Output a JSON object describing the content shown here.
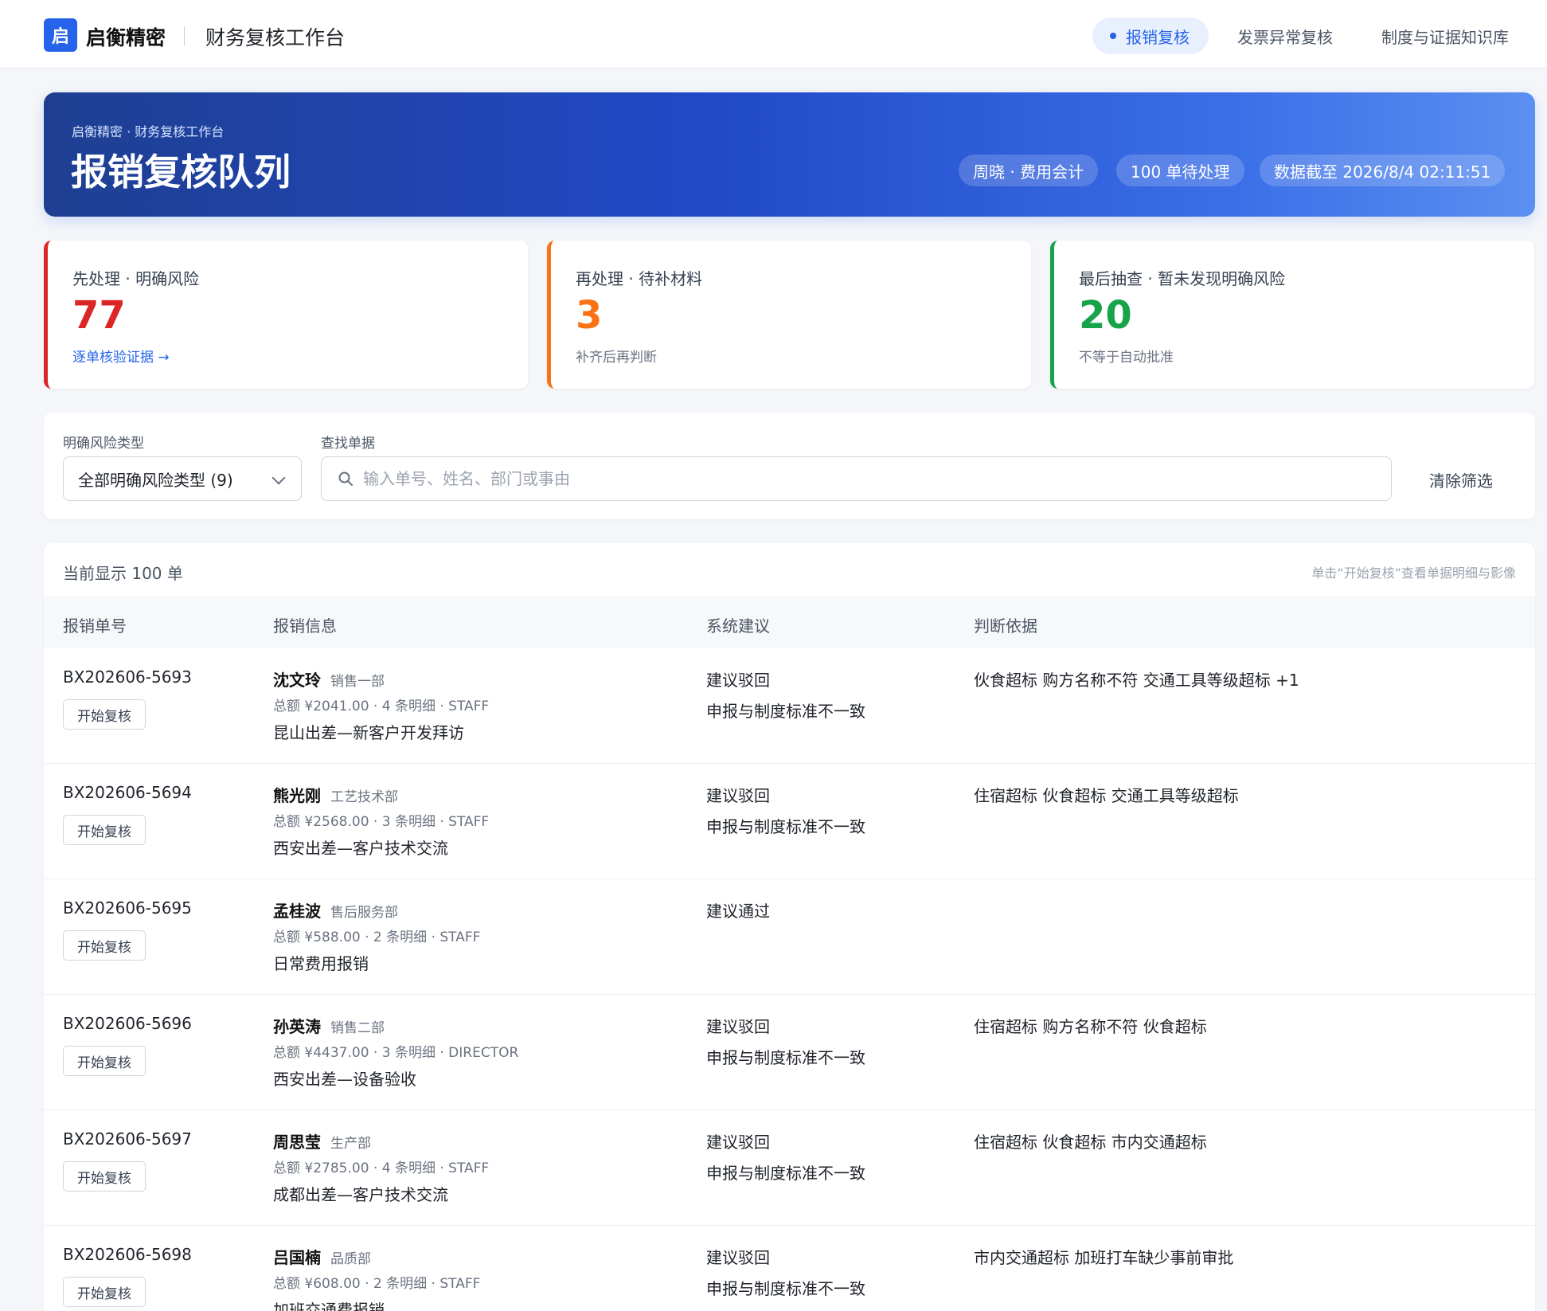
{
  "app": {
    "logo_char": "启",
    "brand": "启衡精密",
    "subtitle": "财务复核工作台"
  },
  "nav": {
    "items": [
      {
        "label": "报销复核",
        "active": true
      },
      {
        "label": "发票异常复核",
        "active": false
      },
      {
        "label": "制度与证据知识库",
        "active": false
      }
    ]
  },
  "banner": {
    "crumb": "启衡精密 · 财务复核工作台",
    "title": "报销复核队列",
    "user": "周晓 · 费用会计",
    "pending": "100 单待处理",
    "data_time": "数据截至 2026/8/4 02:11:51"
  },
  "stats": [
    {
      "label": "先处理 · 明确风险",
      "value": "77",
      "note": "逐单核验证据 →",
      "color": "#dc2626",
      "note_is_link": true
    },
    {
      "label": "再处理 · 待补材料",
      "value": "3",
      "note": "补齐后再判断",
      "color": "#f97316",
      "note_is_link": false
    },
    {
      "label": "最后抽查 · 暂未发现明确风险",
      "value": "20",
      "note": "不等于自动批准",
      "color": "#16a34a",
      "note_is_link": false
    }
  ],
  "filter": {
    "risk_label": "明确风险类型",
    "risk_value": "全部明确风险类型 (9)",
    "search_label": "查找单据",
    "search_placeholder": "输入单号、姓名、部门或事由",
    "search_value": "",
    "clear_label": "清除筛选"
  },
  "table": {
    "count": "当前显示 100 单",
    "hint": "单击“开始复核”查看单据明细与影像",
    "headers": [
      "报销单号",
      "报销信息",
      "系统建议",
      "判断依据"
    ],
    "review_label": "开始复核",
    "rows": [
      {
        "id": "BX202606-5693",
        "name": "沈文玲",
        "dept": "销售一部",
        "meta": "总额 ¥2041.00 · 4 条明细 · STAFF",
        "reason": "昆山出差—新客户开发拜访",
        "suggestion": "建议驳回",
        "suggestion_detail": "申报与制度标准不一致",
        "basis": "伙食超标  购方名称不符  交通工具等级超标  +1"
      },
      {
        "id": "BX202606-5694",
        "name": "熊光刚",
        "dept": "工艺技术部",
        "meta": "总额 ¥2568.00 · 3 条明细 · STAFF",
        "reason": "西安出差—客户技术交流",
        "suggestion": "建议驳回",
        "suggestion_detail": "申报与制度标准不一致",
        "basis": "住宿超标  伙食超标  交通工具等级超标"
      },
      {
        "id": "BX202606-5695",
        "name": "孟桂波",
        "dept": "售后服务部",
        "meta": "总额 ¥588.00 · 2 条明细 · STAFF",
        "reason": "日常费用报销",
        "suggestion": "建议通过",
        "suggestion_detail": "",
        "basis": ""
      },
      {
        "id": "BX202606-5696",
        "name": "孙英涛",
        "dept": "销售二部",
        "meta": "总额 ¥4437.00 · 3 条明细 · DIRECTOR",
        "reason": "西安出差—设备验收",
        "suggestion": "建议驳回",
        "suggestion_detail": "申报与制度标准不一致",
        "basis": "住宿超标  购方名称不符  伙食超标"
      },
      {
        "id": "BX202606-5697",
        "name": "周思莹",
        "dept": "生产部",
        "meta": "总额 ¥2785.00 · 4 条明细 · STAFF",
        "reason": "成都出差—客户技术交流",
        "suggestion": "建议驳回",
        "suggestion_detail": "申报与制度标准不一致",
        "basis": "住宿超标  伙食超标  市内交通超标"
      },
      {
        "id": "BX202606-5698",
        "name": "吕国楠",
        "dept": "品质部",
        "meta": "总额 ¥608.00 · 2 条明细 · STAFF",
        "reason": "加班交通费报销",
        "suggestion": "建议驳回",
        "suggestion_detail": "申报与制度标准不一致",
        "basis": "市内交通超标  加班打车缺少事前审批"
      }
    ]
  }
}
